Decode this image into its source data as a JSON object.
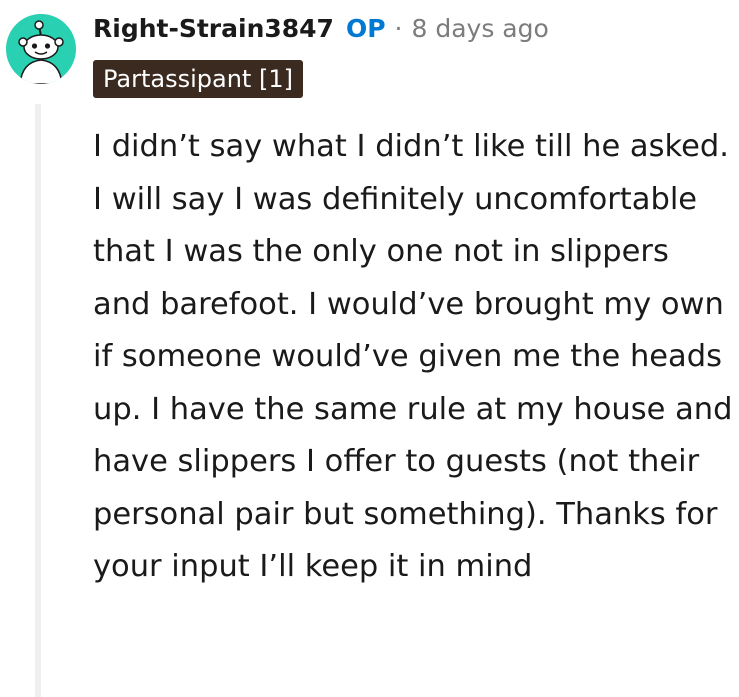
{
  "comment": {
    "username": "Right-Strain3847",
    "op_badge": "OP",
    "separator": "·",
    "timestamp": "8 days ago",
    "flair": "Partassipant [1]",
    "body": "I didn’t say what I didn’t like till he asked. I will say I was definitely uncomfortable that I was the only one not in slippers and barefoot. I would’ve brought my own if someone would’ve given me the heads up. I have the same rule at my house and have slippers I offer to guests (not their personal pair but something). Thanks for your input I’ll keep it in mind",
    "avatar_icon": "reddit-snoo-icon"
  },
  "colors": {
    "avatar_bg": "#2ad0b2",
    "op_color": "#0079d3",
    "flair_bg": "#3b2a20",
    "meta_gray": "#7c7c7c"
  }
}
